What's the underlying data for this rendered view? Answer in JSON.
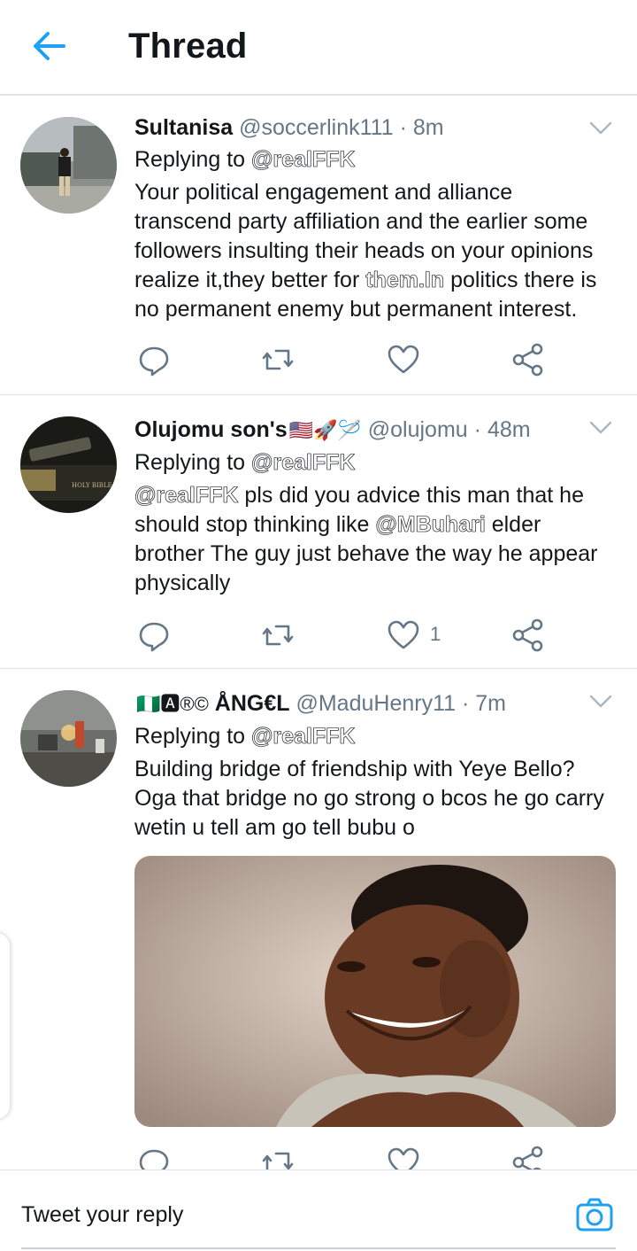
{
  "header": {
    "title": "Thread",
    "back_icon": "arrow-left-icon"
  },
  "tweets": [
    {
      "name": "Sultanisa",
      "handle": "@soccerlink111",
      "dot": "·",
      "time": "8m",
      "replying_prefix": "Replying to",
      "replying_to": "@realFFK",
      "text_a": "Your political engagement and alliance transcend party affiliation and the earlier some followers insulting their heads on your opinions realize it,they better for ",
      "text_link": "them.In",
      "text_b": " politics there is no permanent enemy but permanent interest.",
      "like_count": ""
    },
    {
      "name": "Olujomu son's",
      "emoji": "🇺🇸🚀🪡",
      "handle": "@olujomu",
      "dot": "·",
      "time": "48m",
      "replying_prefix": "Replying to",
      "replying_to": "@realFFK",
      "text_mention1": "@realFFK",
      "text_a": " pls did you advice this man that he should stop thinking like ",
      "text_mention2": "@MBuhari",
      "text_b": " elder brother The guy just behave the way he appear physically",
      "like_count": "1"
    },
    {
      "name_prefix": "🇳🇬🅰®©",
      "name": "ÅNG€L",
      "handle": "@MaduHenry11",
      "dot": "·",
      "time": "7m",
      "replying_prefix": "Replying to",
      "replying_to": "@realFFK",
      "text": "Building bridge of friendship with Yeye Bello? Oga that bridge no go strong o bcos he go carry wetin u tell am go tell bubu o",
      "like_count": ""
    }
  ],
  "reply_bar": {
    "placeholder": "Tweet your reply",
    "camera_icon": "camera-icon"
  },
  "colors": {
    "accent": "#1da1f2",
    "text": "#14171a",
    "secondary": "#657786",
    "divider": "#dfe3e7"
  }
}
